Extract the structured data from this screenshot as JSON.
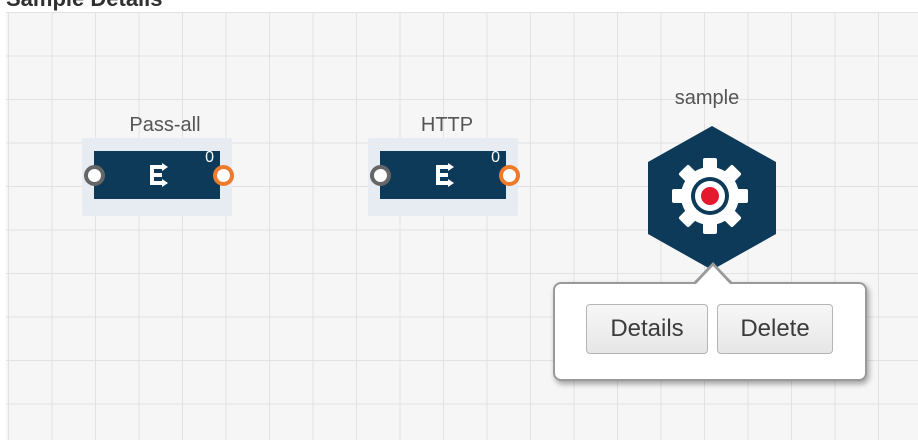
{
  "header": {
    "title": "Sample Details"
  },
  "nodes": [
    {
      "label": "Pass-all",
      "count": "0"
    },
    {
      "label": "HTTP",
      "count": "0"
    }
  ],
  "app_node": {
    "label": "sample"
  },
  "popup": {
    "details_label": "Details",
    "delete_label": "Delete"
  },
  "colors": {
    "node_fill": "#0d3a58",
    "port_out": "#ee7a2a",
    "target_red": "#e5192d",
    "canvas_bg": "#f6f6f6"
  }
}
